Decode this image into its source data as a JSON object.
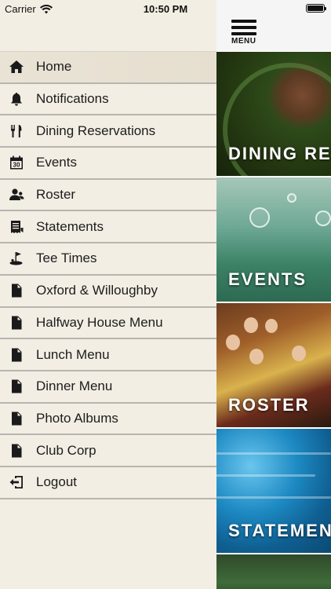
{
  "status_bar": {
    "carrier": "Carrier",
    "time": "10:50 PM"
  },
  "menu": {
    "items": [
      {
        "label": "Home",
        "icon": "home-icon"
      },
      {
        "label": "Notifications",
        "icon": "bell-icon"
      },
      {
        "label": "Dining Reservations",
        "icon": "fork-knife-icon"
      },
      {
        "label": "Events",
        "icon": "calendar-icon"
      },
      {
        "label": "Roster",
        "icon": "people-icon"
      },
      {
        "label": "Statements",
        "icon": "receipt-icon"
      },
      {
        "label": "Tee Times",
        "icon": "golf-icon"
      },
      {
        "label": "Oxford & Willoughby",
        "icon": "document-icon"
      },
      {
        "label": "Halfway House Menu",
        "icon": "document-icon"
      },
      {
        "label": "Lunch Menu",
        "icon": "document-icon"
      },
      {
        "label": "Dinner Menu",
        "icon": "document-icon"
      },
      {
        "label": "Photo Albums",
        "icon": "document-icon"
      },
      {
        "label": "Club Corp",
        "icon": "document-icon"
      },
      {
        "label": "Logout",
        "icon": "logout-icon"
      }
    ],
    "calendar_icon_day": "30"
  },
  "main": {
    "menu_button_label": "MENU",
    "tiles": {
      "dining": "DINING RESERVATIONS",
      "events": "EVENTS",
      "roster": "ROSTER",
      "statements": "STATEMENTS"
    }
  },
  "colors": {
    "drawer_background": "#f3eee4",
    "active_row": "#e9e3d6",
    "row_divider": "#b9b5ae",
    "icon_color": "#1a1a1a"
  }
}
